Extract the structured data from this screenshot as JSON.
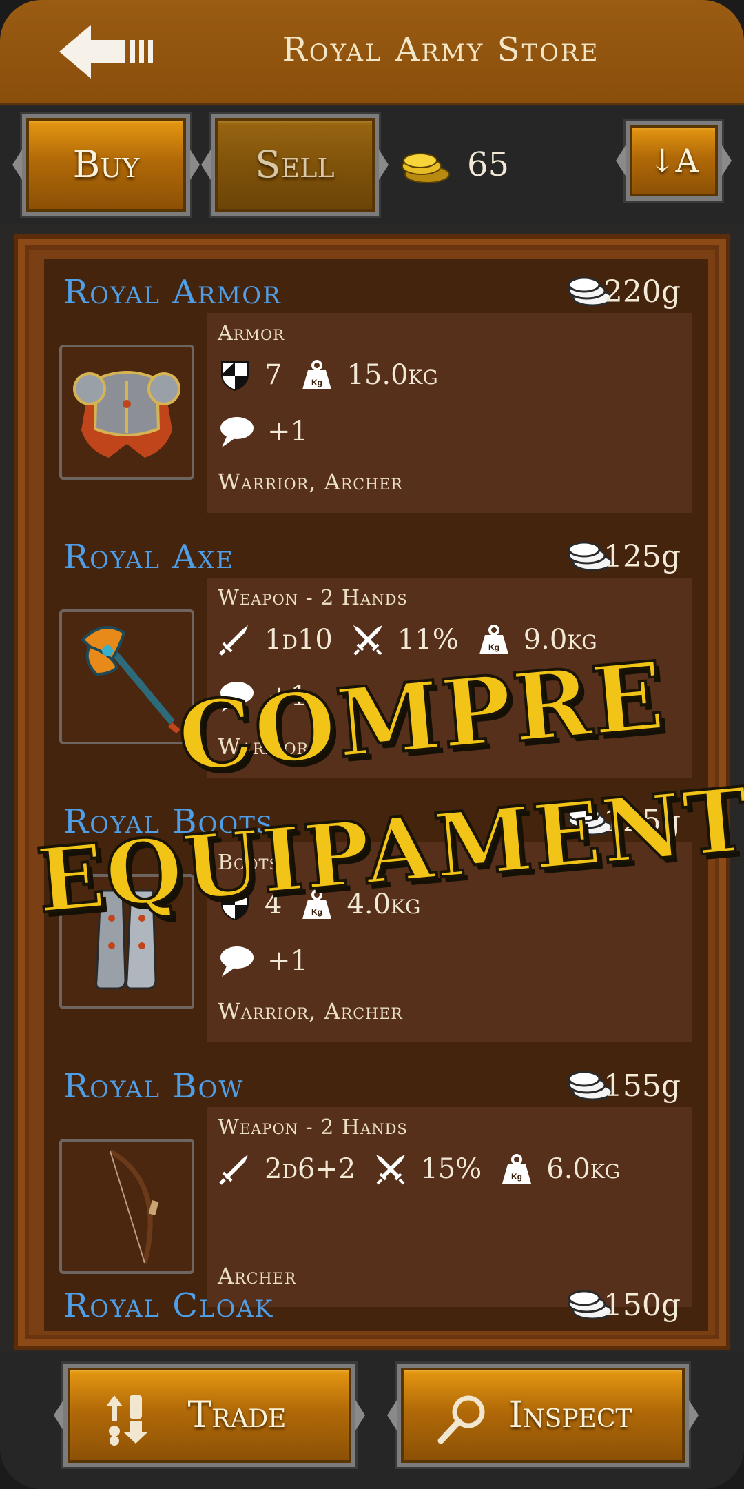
{
  "header": {
    "title": "Royal Army Store",
    "back_icon": "back-arrow-icon"
  },
  "toolbar": {
    "buy_label": "Buy",
    "sell_label": "Sell",
    "sort_label": "↓A",
    "coins": "65",
    "coin_icon": "gold-coins-icon"
  },
  "items": [
    {
      "name": "Royal Armor",
      "price": "220g",
      "type": "Armor",
      "stats": [
        {
          "icon": "shield-icon",
          "value": "7"
        },
        {
          "icon": "weight-icon",
          "value": "15.0kg"
        }
      ],
      "bonus": "+1",
      "classes": "Warrior, Archer"
    },
    {
      "name": "Royal Axe",
      "price": "125g",
      "type": "Weapon - 2 Hands",
      "stats": [
        {
          "icon": "sword-icon",
          "value": "1d10"
        },
        {
          "icon": "crossed-swords-icon",
          "value": "11%"
        },
        {
          "icon": "weight-icon",
          "value": "9.0kg"
        }
      ],
      "bonus": "+1",
      "classes": "Warrior"
    },
    {
      "name": "Royal Boots",
      "price": "125g",
      "type": "Boots",
      "stats": [
        {
          "icon": "shield-icon",
          "value": "4"
        },
        {
          "icon": "weight-icon",
          "value": "4.0kg"
        }
      ],
      "bonus": "+1",
      "classes": "Warrior, Archer"
    },
    {
      "name": "Royal Bow",
      "price": "155g",
      "type": "Weapon - 2 Hands",
      "stats": [
        {
          "icon": "sword-icon",
          "value": "2d6+2"
        },
        {
          "icon": "crossed-swords-icon",
          "value": "15%"
        },
        {
          "icon": "weight-icon",
          "value": "6.0kg"
        }
      ],
      "bonus": "",
      "classes": "Archer"
    },
    {
      "name": "Royal Cloak",
      "price": "150g",
      "type": "",
      "stats": [],
      "bonus": "",
      "classes": ""
    }
  ],
  "promo": {
    "line1": "COMPRE",
    "line2": "EQUIPAMENTOS",
    "color": "#f2c417"
  },
  "bottom": {
    "trade_label": "Trade",
    "inspect_label": "Inspect"
  },
  "colors": {
    "header": "#8f530f",
    "item_name": "#4f9ee8",
    "gold": "#e89a12"
  }
}
